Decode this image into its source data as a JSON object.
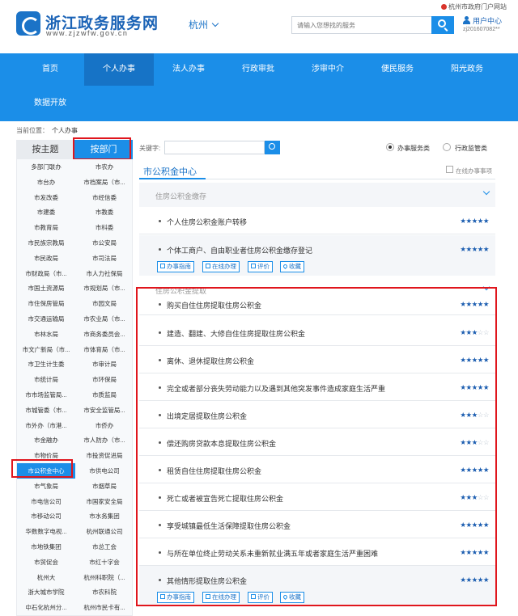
{
  "header": {
    "site_title": "浙江政务服务网",
    "site_url": "www.zjzwfw.gov.cn",
    "city": "杭州",
    "search_placeholder": "请输入您想找的服务",
    "portal_link": "杭州市政府门户网站",
    "user_center": "用户中心",
    "user_id": "zj201607082**"
  },
  "nav": {
    "items": [
      "首页",
      "个人办事",
      "法人办事",
      "行政审批",
      "涉审中介",
      "便民服务",
      "阳光政务",
      "数据开放"
    ],
    "active": "个人办事"
  },
  "breadcrumb": {
    "label": "当前位置：",
    "current": "个人办事"
  },
  "tabs": {
    "by_topic": "按主题",
    "by_dept": "按部门"
  },
  "departments": [
    [
      "多部门联办",
      "市农办"
    ],
    [
      "市台办",
      "市档案局（市..."
    ],
    [
      "市发改委",
      "市经信委"
    ],
    [
      "市建委",
      "市教委"
    ],
    [
      "市教育局",
      "市科委"
    ],
    [
      "市民族宗教局",
      "市公安局"
    ],
    [
      "市民政局",
      "市司法局"
    ],
    [
      "市财政局（市...",
      "市人力社保局"
    ],
    [
      "市国土资源局",
      "市规划局（市..."
    ],
    [
      "市住保房管局",
      "市园文局"
    ],
    [
      "市交通运输局",
      "市农业局（市..."
    ],
    [
      "市林水局",
      "市商务委员会..."
    ],
    [
      "市文广新局（市...",
      "市体育局（市..."
    ],
    [
      "市卫生计生委",
      "市审计局"
    ],
    [
      "市统计局",
      "市环保局"
    ],
    [
      "市市场监管局...",
      "市质监局"
    ],
    [
      "市城管委（市...",
      "市安全监管局..."
    ],
    [
      "市外办（市港...",
      "市侨办"
    ],
    [
      "市金融办",
      "市人防办（市..."
    ],
    [
      "市物价局",
      "市投资促进局"
    ],
    [
      "市公积金中心",
      "市供电公司"
    ],
    [
      "市气象局",
      "市烟草局"
    ],
    [
      "市电信公司",
      "市国家安全局"
    ],
    [
      "市移动公司",
      "市水务集团"
    ],
    [
      "华数数字电视...",
      "杭州联通公司"
    ],
    [
      "市地铁集团",
      "市总工会"
    ],
    [
      "市贸促会",
      "市红十字会"
    ],
    [
      "杭州大",
      "杭州科职院（..."
    ],
    [
      "浙大城市学院",
      "市农科院"
    ],
    [
      "中石化杭州分...",
      "杭州市民卡有..."
    ]
  ],
  "active_department": "市公积金中心",
  "filter": {
    "keyword_label": "关键字:",
    "radio_service": "办事服务类",
    "radio_supervision": "行政监管类"
  },
  "center": {
    "title": "市公积金中心",
    "online_label": "在线办事事项",
    "group1_title": "住房公积金缴存",
    "group2_title": "住房公积金提取",
    "rows": [
      {
        "text": "个人住房公积金账户转移",
        "rating": 5
      },
      {
        "text": "个体工商户、自由职业者住房公积金缴存登记",
        "rating": 5
      },
      {
        "text": "购买自住住房提取住房公积金",
        "rating": 5
      },
      {
        "text": "建造、翻建、大修自住住房提取住房公积金",
        "rating": 3
      },
      {
        "text": "离休、退休提取住房公积金",
        "rating": 5
      },
      {
        "text": "完全或者部分丧失劳动能力以及遇到其他突发事件造成家庭生活严重",
        "rating": 5
      },
      {
        "text": "出境定居提取住房公积金",
        "rating": 3
      },
      {
        "text": "偿还购房贷款本息提取住房公积金",
        "rating": 3
      },
      {
        "text": "租赁自住住房提取住房公积金",
        "rating": 5
      },
      {
        "text": "死亡或者被宣告死亡提取住房公积金",
        "rating": 3
      },
      {
        "text": "享受城镇最低生活保障提取住房公积金",
        "rating": 5
      },
      {
        "text": "与所在单位终止劳动关系未重新就业满五年或者家庭生活严重困难",
        "rating": 5
      },
      {
        "text": "其他情形提取住房公积金",
        "rating": 5
      }
    ],
    "actions": [
      "办事指南",
      "在线办理",
      "评价",
      "收藏"
    ]
  },
  "colors": {
    "brand": "#1b8ee8",
    "nav_active": "#1673c6",
    "highlight_frame": "#e0161d",
    "star": "#1b5db0"
  }
}
